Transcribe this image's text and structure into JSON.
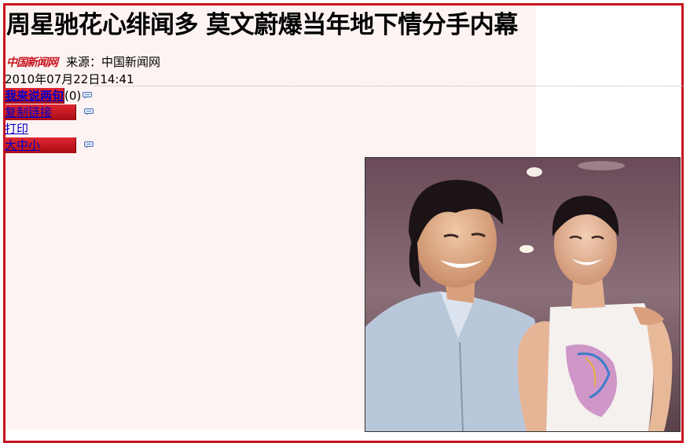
{
  "article": {
    "title": "周星驰花心绯闻多 莫文蔚爆当年地下情分手内幕",
    "logo_text": "中国新闻网",
    "source_label": "来源：中国新闻网",
    "datetime": "2010年07月22日14:41"
  },
  "toolbar": {
    "comment_label": "我来说两句",
    "comment_count": "(0)",
    "copy_link_label": "复制链接",
    "print_label": "打印",
    "font_size_label": "大中小"
  },
  "colors": {
    "frame_red": "#c8141e",
    "pane_pink": "#fdf3f2",
    "link_blue": "#0000cc"
  },
  "icons": [
    "chat-bubble-icon"
  ]
}
